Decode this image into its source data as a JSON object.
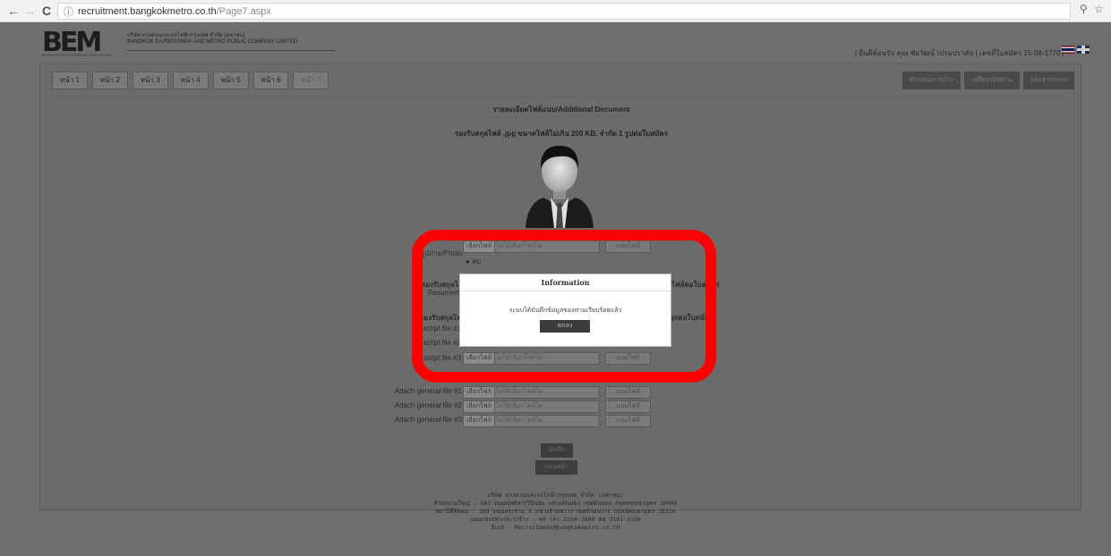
{
  "browser": {
    "back_glyph": "←",
    "forward_glyph": "→",
    "reload_glyph": "C",
    "info_glyph": "ⓘ",
    "url_host": "recruitment.bangkokmetro.co.th",
    "url_path": "/Page7.aspx",
    "zoom_glyph": "⚲",
    "star_glyph": "☆"
  },
  "header": {
    "logo_text": "BEM",
    "logo_subtext": "BANGKOK EXPRESSWAY AND METRO",
    "company_th": "บริษัท ทางด่วนและรถไฟฟ้ากรุงเทพ จำกัด (มหาชน)",
    "company_en": "BANGKOK EXPRESSWAY AND METRO PUBLIC COMPANY LIMITED",
    "welcome": "| ยินดีต้อนรับ คุณ ชัยวัฒน์ เปรมปราคัย | เลขที่ใบสมัคร 15-08-1770 |"
  },
  "tabs": [
    {
      "label": "หน้า 1"
    },
    {
      "label": "หน้า 2"
    },
    {
      "label": "หน้า 3"
    },
    {
      "label": "หน้า 4"
    },
    {
      "label": "หน้า 5"
    },
    {
      "label": "หน้า 6"
    },
    {
      "label": "หน้า 7"
    }
  ],
  "actions": {
    "positions": "ตำแหน่งงานว่าง",
    "change_password": "เปลี่ยนรหัสผ่าน",
    "logout": "ออกจากระบบ"
  },
  "page": {
    "title": "รายละเอียดไฟล์แนบ/Additional Document",
    "photo_note": "รองรับสกุลไฟล์ .jpg ขนาดไฟล์ไม่เกิน 200 KB. จำกัด 1 รูปต่อใบสมัคร",
    "photo_label": "รูปถ่าย/Photo",
    "delete_label": "ลบ",
    "resume_note": "รองรับสกุลไ",
    "resume_note_right": "ไฟล์ต่อใบสมัคร",
    "resume_label": "Resume/C",
    "transcript_note": "รองรับสกุลไฟ",
    "transcript_note_right": "ptต่อใบสมัค",
    "transcript_1": "nscript file #1",
    "transcript_2": "nscript file #2",
    "transcript_3": "nscript file #3",
    "choose_file": "เลือกไฟล์",
    "no_file": "ไม่ได้เลือกไฟล์ใด",
    "attach": "แนบไฟล์",
    "general_1": "Attach general file #1",
    "general_2": "Attach general file #2",
    "general_3": "Attach general file #3",
    "save": "บันทึก",
    "back": "ก่อนหน้า"
  },
  "footer": {
    "line1": "บริษัท ทางด่วนและรถไฟฟ้ากรุงเทพ จำกัด (มหาชน)",
    "line2": "สำนักงานใหญ่ : 587 ถนนสุทธิสารวินิจฉัย แขวงดินแดง เขตดินแดง กรุงเทพมหานคร 10400",
    "line3": "สถานีที่ติดต่อ : 189 ถนนพระราม 9 แขวงห้วยขวาง เขตห้วยขวาง กรุงเทพมหานคร 10310",
    "line4": "แผนกสรรหาและว่าจ้าง : 66 (0) 2354-2000 ต่อ 3101-3106",
    "line5": "อีเมล์ : Recruitment@bangkokmetro.co.th"
  },
  "modal": {
    "title": "Information",
    "message": "ระบบได้บันทึกข้อมูลของท่านเรียบร้อยแล้ว",
    "ok": "ตกลง"
  }
}
